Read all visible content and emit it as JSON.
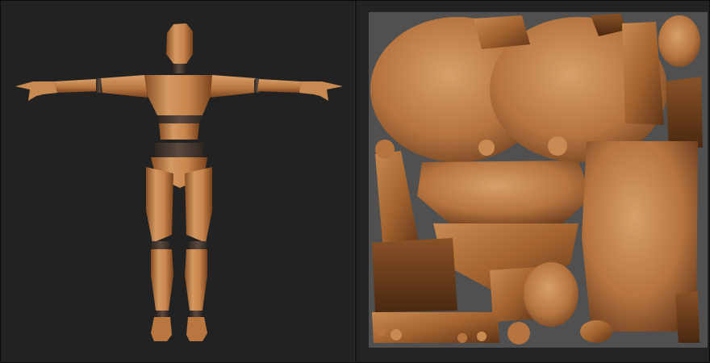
{
  "panels": {
    "viewport": "3d-viewport",
    "uv_editor": "uv-editor"
  },
  "colors": {
    "viewport_bg": "#222222",
    "uv_canvas_bg": "#505050",
    "wood_light": "#d89a62",
    "wood_mid": "#b6743f",
    "wood_dark": "#6b3d1e",
    "joint_dark": "#4a3a32"
  },
  "icons": {
    "mannequin": "wooden-mannequin-model",
    "uv_islands": "uv-texture-islands"
  }
}
